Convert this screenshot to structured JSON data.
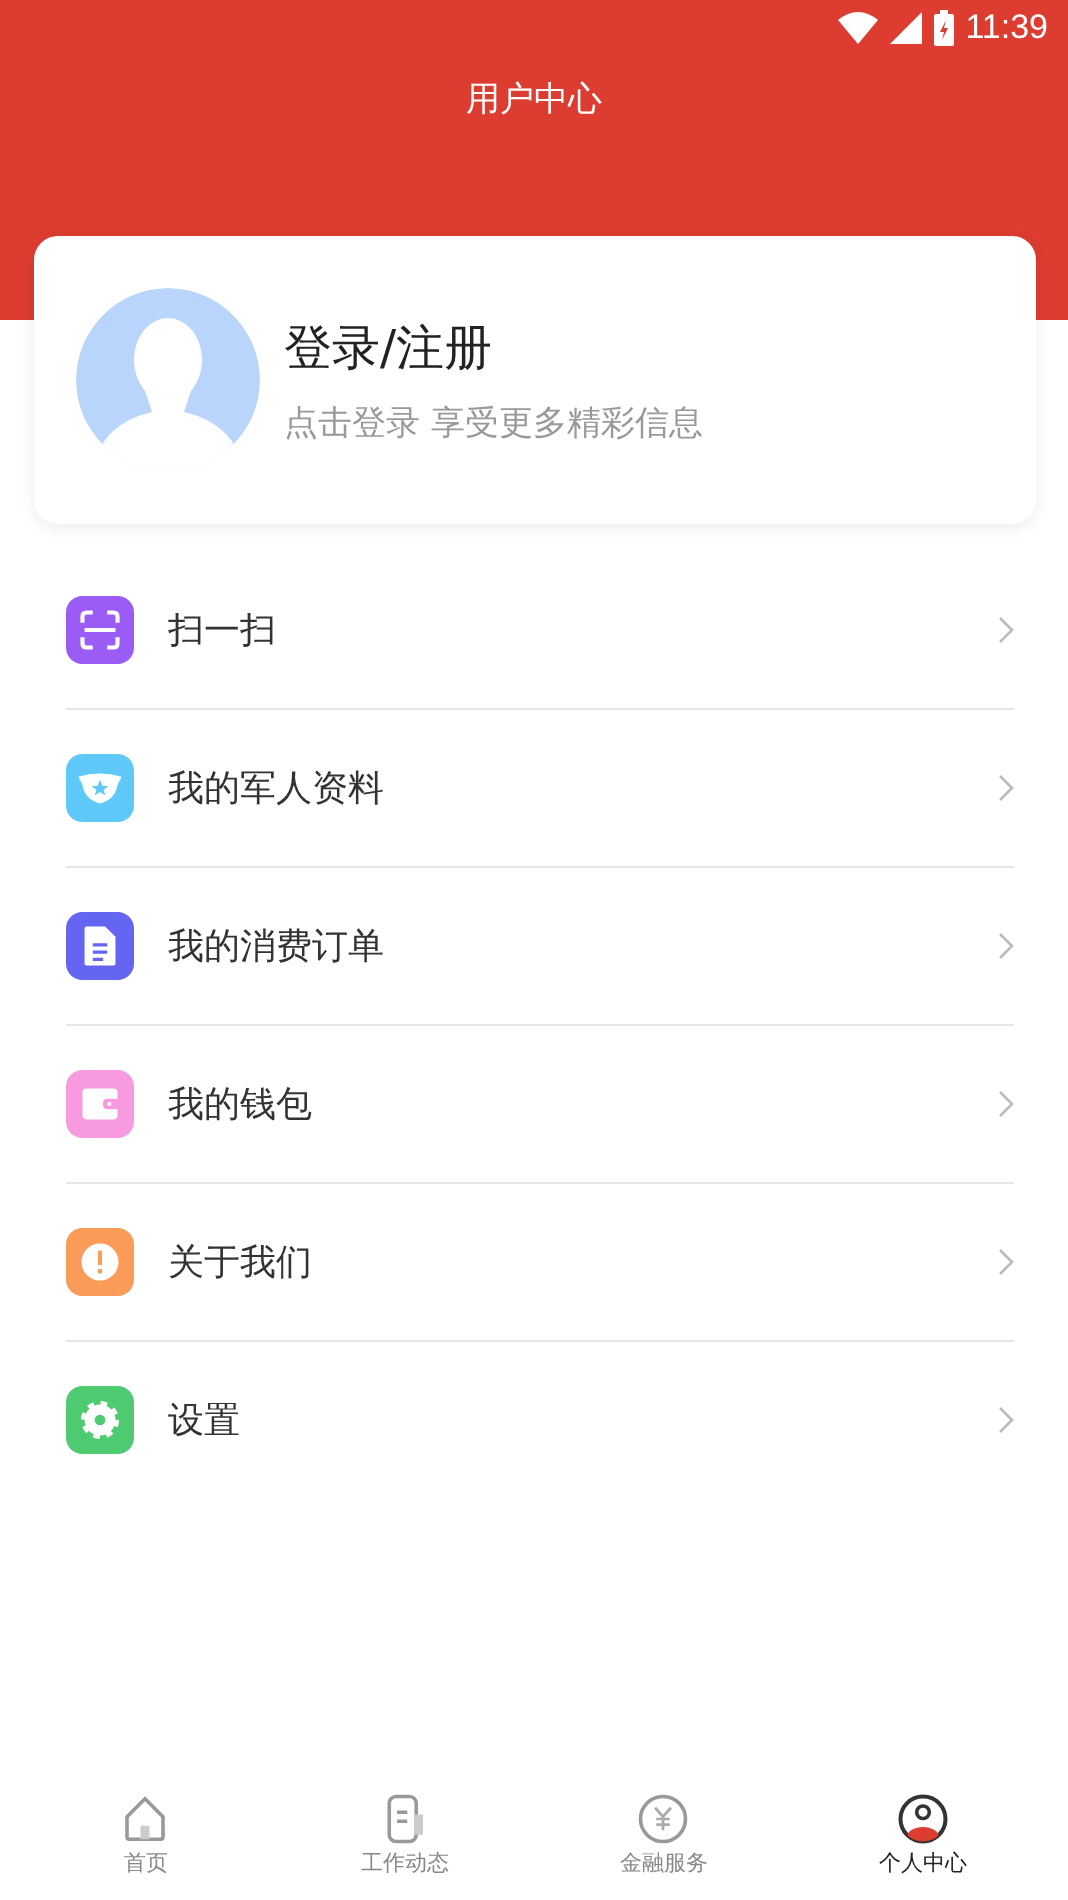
{
  "status_bar": {
    "time": "11:39"
  },
  "header": {
    "title": "用户中心"
  },
  "login_card": {
    "title": "登录/注册",
    "subtitle": "点击登录 享受更多精彩信息"
  },
  "menu": [
    {
      "label": "扫一扫",
      "kind": "scan",
      "color": "#9b5cf6"
    },
    {
      "label": "我的军人资料",
      "kind": "badge",
      "color": "#5ec8f8"
    },
    {
      "label": "我的消费订单",
      "kind": "document",
      "color": "#6466f1"
    },
    {
      "label": "我的钱包",
      "kind": "wallet",
      "color": "#f79ae0"
    },
    {
      "label": "关于我们",
      "kind": "info",
      "color": "#fa9b5a"
    },
    {
      "label": "设置",
      "kind": "settings",
      "color": "#4ecb71"
    }
  ],
  "bottom_nav": [
    {
      "label": "首页",
      "kind": "home",
      "selected": false
    },
    {
      "label": "工作动态",
      "kind": "news",
      "selected": false
    },
    {
      "label": "金融服务",
      "kind": "finance",
      "selected": false
    },
    {
      "label": "个人中心",
      "kind": "profile",
      "selected": true
    }
  ]
}
